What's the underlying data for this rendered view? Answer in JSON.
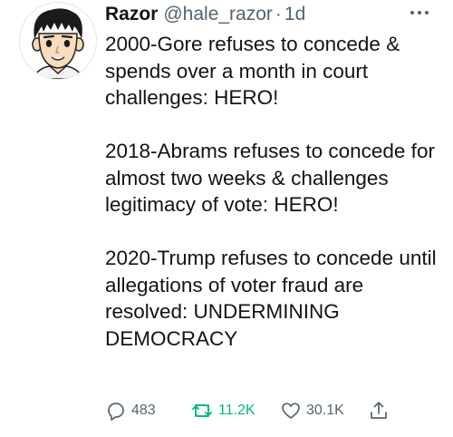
{
  "tweet": {
    "author_name": "Razor",
    "handle": "@hale_razor",
    "separator": "·",
    "time": "1d",
    "paragraphs": [
      "2000-Gore refuses to concede & spends over a month in court challenges: HERO!",
      "2018-Abrams refuses to concede for almost two weeks & challenges legitimacy of vote: HERO!",
      "2020-Trump refuses to concede until allegations of voter fraud are resolved: UNDERMINING DEMOCRACY"
    ]
  },
  "actions": {
    "reply_count": "483",
    "retweet_count": "11.2K",
    "like_count": "30.1K"
  },
  "icons": {
    "avatar": "cartoon-avatar",
    "more": "more-icon",
    "reply": "reply-icon",
    "retweet": "retweet-icon",
    "like": "heart-icon",
    "share": "share-icon"
  },
  "colors": {
    "text": "#0f1419",
    "secondary": "#536471",
    "retweet_active": "#00ba7c"
  }
}
